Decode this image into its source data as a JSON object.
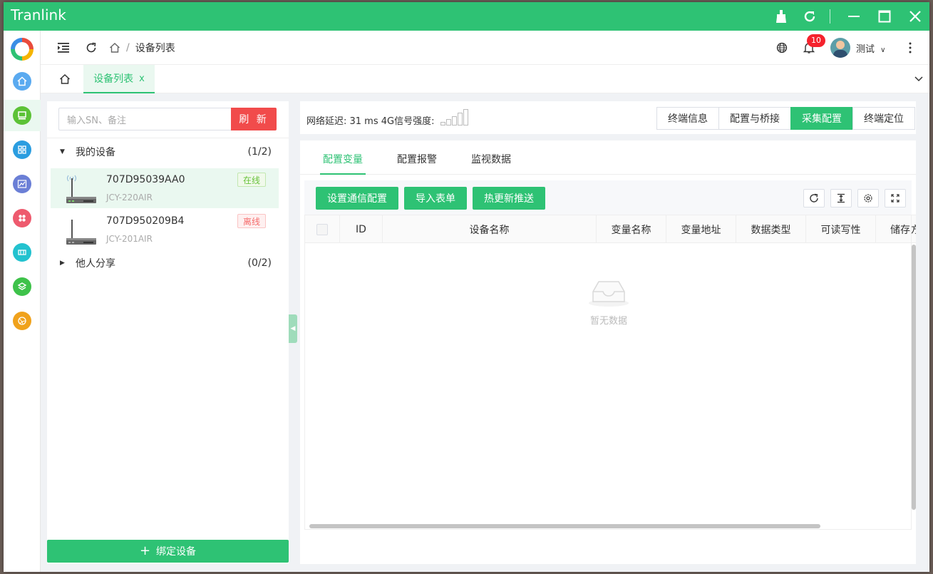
{
  "window": {
    "title": "Tranlink"
  },
  "header": {
    "breadcrumb": [
      "设备列表"
    ],
    "notification_count": "10",
    "user_name": "测试"
  },
  "tabs": [
    {
      "label": "设备列表",
      "close": "x"
    }
  ],
  "left_panel": {
    "search_placeholder": "输入SN、备注",
    "refresh_label": "刷 新",
    "groups": [
      {
        "label": "我的设备",
        "count": "(1/2)",
        "expanded": true
      },
      {
        "label": "他人分享",
        "count": "(0/2)",
        "expanded": false
      }
    ],
    "devices": [
      {
        "sn": "707D95039AA0",
        "model": "JCY-220AIR",
        "status": "在线",
        "online": true
      },
      {
        "sn": "707D950209B4",
        "model": "JCY-201AIR",
        "status": "离线",
        "online": false
      }
    ],
    "bind_label": "绑定设备"
  },
  "status_bar": {
    "text": "网络延迟: 31 ms 4G信号强度:",
    "signal_level": 0
  },
  "top_tabs": [
    {
      "label": "终端信息",
      "active": false
    },
    {
      "label": "配置与桥接",
      "active": false
    },
    {
      "label": "采集配置",
      "active": true
    },
    {
      "label": "终端定位",
      "active": false
    }
  ],
  "sub_tabs": [
    {
      "label": "配置变量",
      "active": true
    },
    {
      "label": "配置报警",
      "active": false
    },
    {
      "label": "监视数据",
      "active": false
    }
  ],
  "toolbar": {
    "buttons": [
      "设置通信配置",
      "导入表单",
      "热更新推送"
    ]
  },
  "table": {
    "columns": [
      "ID",
      "设备名称",
      "变量名称",
      "变量地址",
      "数据类型",
      "可读写性",
      "储存方式"
    ],
    "empty_text": "暂无数据"
  },
  "colors": {
    "brand": "#2ec274",
    "danger": "#f14b4b"
  }
}
